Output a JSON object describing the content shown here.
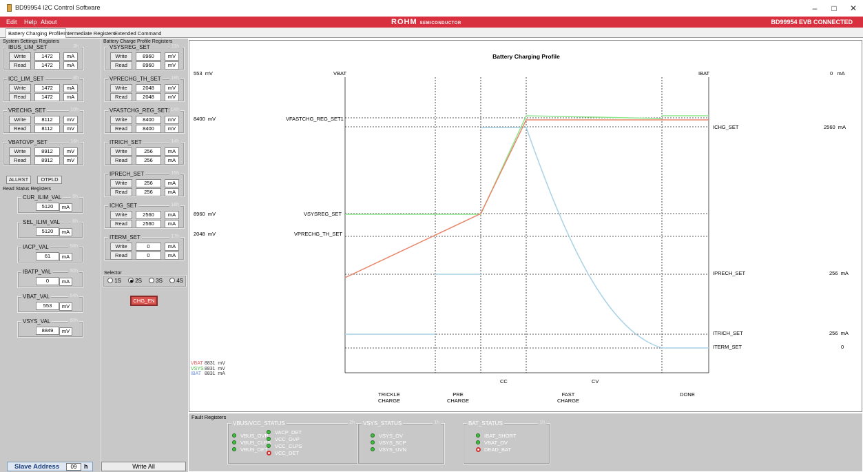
{
  "window": {
    "title": "BD99954 I2C Control Software",
    "min": "–",
    "max": "□",
    "close": "✕"
  },
  "menu": {
    "items": [
      "Edit",
      "Help",
      "About"
    ],
    "logo": "ROHM",
    "logo_sub": "SEMICONDUCTOR",
    "status": "BD99954 EVB CONNECTED"
  },
  "tabs": [
    "Battery Charging Profile",
    "Intermediate Registers",
    "Extended Command"
  ],
  "sys_panel": {
    "title": "System Settings Registers",
    "groups": [
      {
        "name": "IBUS_LIM_SET",
        "addr": "3h",
        "write": "1472",
        "read": "1472",
        "unit": "mA"
      },
      {
        "name": "ICC_LIM_SET",
        "addr": "8h",
        "write": "1472",
        "read": "1472",
        "unit": "mA"
      },
      {
        "name": "VRECHG_SET",
        "addr": "10h",
        "write": "8112",
        "read": "8112",
        "unit": "mV"
      },
      {
        "name": "VBATOVP_SET",
        "addr": "16h",
        "write": "8912",
        "read": "8912",
        "unit": "mV"
      }
    ],
    "allrst": "ALLRST",
    "otpld": "OTPLD",
    "write_label": "Write",
    "read_label": "Read"
  },
  "status_panel": {
    "title": "Read Status Registers",
    "groups": [
      {
        "name": "CUR_ILIM_VAL",
        "addr": "5h",
        "value": "5120",
        "unit": "mA"
      },
      {
        "name": "SEL_ILIM_VAL",
        "addr": "6h",
        "value": "5120",
        "unit": "mA"
      },
      {
        "name": "IACP_VAL",
        "addr": "58h",
        "value": "61",
        "unit": "mA"
      },
      {
        "name": "IBATP_VAL",
        "addr": "50h",
        "value": "0",
        "unit": "mA"
      },
      {
        "name": "VBAT_VAL",
        "addr": "54h",
        "value": "553",
        "unit": "mV"
      },
      {
        "name": "VSYS_VAL",
        "addr": "60h",
        "value": "8849",
        "unit": "mV"
      }
    ]
  },
  "profile_panel": {
    "title": "Battery Charge Profile Registers",
    "groups": [
      {
        "name": "VSYSREG_SET",
        "addr": "11h",
        "write": "8960",
        "read": "8960",
        "unit": "mV"
      },
      {
        "name": "VPRECHG_TH_SET",
        "addr": "18h",
        "write": "2048",
        "read": "2048",
        "unit": "mV"
      },
      {
        "name": "VFASTCHG_REG_SET1",
        "addr": "1Ah",
        "write": "8400",
        "read": "8400",
        "unit": "mV"
      },
      {
        "name": "ITRICH_SET",
        "addr": "14h",
        "write": "256",
        "read": "256",
        "unit": "mA"
      },
      {
        "name": "IPRECH_SET",
        "addr": "15h",
        "write": "256",
        "read": "256",
        "unit": "mA"
      },
      {
        "name": "ICHG_SET",
        "addr": "16h",
        "write": "2560",
        "read": "2560",
        "unit": "mA"
      },
      {
        "name": "ITERM_SET",
        "addr": "17h",
        "write": "0",
        "read": "0",
        "unit": "mA"
      }
    ],
    "selector": {
      "title": "Selector",
      "options": [
        "1S",
        "2S",
        "3S",
        "4S"
      ],
      "selected": "2S"
    },
    "chg_en": "CHG_EN"
  },
  "slave": {
    "label": "Slave Address",
    "value": "09",
    "suffix": "h"
  },
  "write_all": "Write All",
  "chart": {
    "title": "Battery Charging Profile",
    "vbat_label": "VBAT",
    "ibat_label": "IBAT",
    "left_readouts": [
      {
        "value": "553",
        "unit": "mV"
      },
      {
        "value": "8400",
        "unit": "mV"
      },
      {
        "value": "8960",
        "unit": "mV"
      },
      {
        "value": "2048",
        "unit": "mV"
      }
    ],
    "left_names": [
      "VFASTCHG_REG_SET1",
      "VSYSREG_SET",
      "VPRECHG_TH_SET"
    ],
    "right_readouts": [
      {
        "name": "",
        "value": "0",
        "unit": "mA"
      },
      {
        "name": "ICHG_SET",
        "value": "2560",
        "unit": "mA"
      },
      {
        "name": "IPRECH_SET",
        "value": "256",
        "unit": "mA"
      },
      {
        "name": "ITRICH_SET",
        "value": "256",
        "unit": "mA"
      },
      {
        "name": "ITERM_SET",
        "value": "0",
        "unit": ""
      }
    ],
    "legend": [
      {
        "name": "VBAT",
        "value": "8831",
        "unit": "mV",
        "color": "#e06060"
      },
      {
        "name": "VSYS",
        "value": "8831",
        "unit": "mV",
        "color": "#40c040"
      },
      {
        "name": "IBAT",
        "value": "8831",
        "unit": "mA",
        "color": "#6a8ad8"
      }
    ],
    "cc": "CC",
    "cv": "CV",
    "phases": [
      "TRICKLE\nCHARGE",
      "PRE\nCHARGE",
      "FAST\nCHARGE",
      "DONE"
    ],
    "colors": {
      "vbat": "#e8866a",
      "vsys": "#8ee68e",
      "ibat": "#a9d2e6"
    }
  },
  "fault": {
    "title": "Fault Registers",
    "groups": [
      {
        "name": "VBUS/VCC_STATUS",
        "addr": "2h",
        "items": [
          {
            "label": "VBUS_OVP",
            "state": "ok"
          },
          {
            "label": "VBUS_CLPS",
            "state": "ok"
          },
          {
            "label": "VBUS_DET",
            "state": "ok"
          },
          {
            "label": "VACP_DET",
            "state": "ok"
          },
          {
            "label": "VCC_OVP",
            "state": "ok"
          },
          {
            "label": "VCC_CLPS",
            "state": "ok"
          },
          {
            "label": "VCC_DET",
            "state": "fault"
          }
        ]
      },
      {
        "name": "VSYS_STATUS",
        "addr": "1h",
        "items": [
          {
            "label": "VSYS_OV",
            "state": "ok"
          },
          {
            "label": "VSYS_SCP",
            "state": "ok"
          },
          {
            "label": "VSYS_UVN",
            "state": "ok"
          }
        ]
      },
      {
        "name": "BAT_STATUS",
        "addr": "1h",
        "items": [
          {
            "label": "IBAT_SHORT",
            "state": "ok"
          },
          {
            "label": "VBAT_OV",
            "state": "ok"
          },
          {
            "label": "DEAD_BAT",
            "state": "fault"
          }
        ]
      }
    ]
  }
}
